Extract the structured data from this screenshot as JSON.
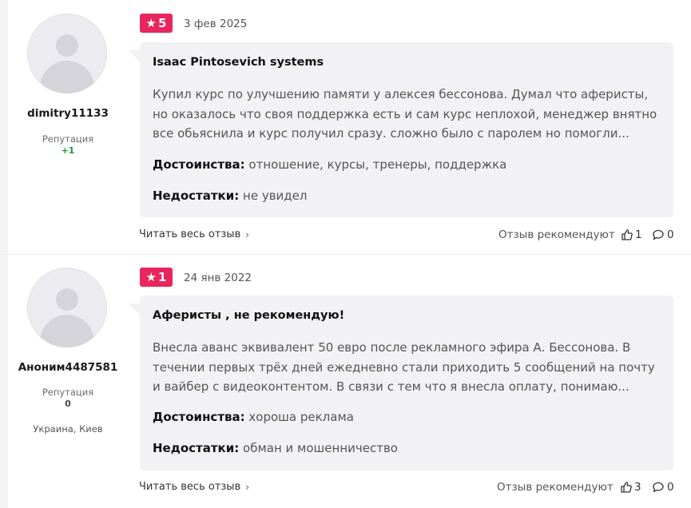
{
  "reviews": [
    {
      "user": {
        "name": "dimitry11133",
        "reputation_label": "Репутация",
        "reputation_value": "+1",
        "location": ""
      },
      "rating": "5",
      "date": "3 фев 2025",
      "title": "Isaac Pintosevich systems",
      "text": "Купил курс по улучшению памяти у алексея бессонова. Думал что аферисты, но оказалось что своя поддержка есть и сам курс неплохой, менеджер внятно все обьяснила и курс получил сразу. сложно было с паролем но помогли...",
      "pros_label": "Достоинства:",
      "pros": "отношение, курсы, тренеры, поддержка",
      "cons_label": "Недостатки:",
      "cons": "не увидел",
      "read_more": "Читать весь отзыв",
      "recommend_label": "Отзыв рекомендуют",
      "likes": "1",
      "comments": "0"
    },
    {
      "user": {
        "name": "Аноним4487581",
        "reputation_label": "Репутация",
        "reputation_value": "0",
        "location": "Украина, Киев"
      },
      "rating": "1",
      "date": "24 янв 2022",
      "title": "Аферисты , не рекомендую!",
      "text": "Внесла аванс эквивалент 50 евро после рекламного эфира А. Бессонова. В течении первых трёх дней ежедневно стали приходить 5 сообщений на почту и вайбер с видеоконтентом. В связи с тем что я внесла оплату, понимаю...",
      "pros_label": "Достоинства:",
      "pros": "хороша реклама",
      "cons_label": "Недостатки:",
      "cons": "обман и мошенничество",
      "read_more": "Читать весь отзыв",
      "recommend_label": "Отзыв рекомендуют",
      "likes": "3",
      "comments": "0"
    }
  ],
  "icons": {
    "star": "star-icon",
    "like": "thumbs-up-icon",
    "comment": "comment-icon",
    "chevron": "chevron-right-icon",
    "avatar": "user-avatar-icon"
  },
  "colors": {
    "rating_badge": "#e8265e",
    "reputation_positive": "#1c9a3a",
    "card_bg": "#f2f2f4"
  }
}
